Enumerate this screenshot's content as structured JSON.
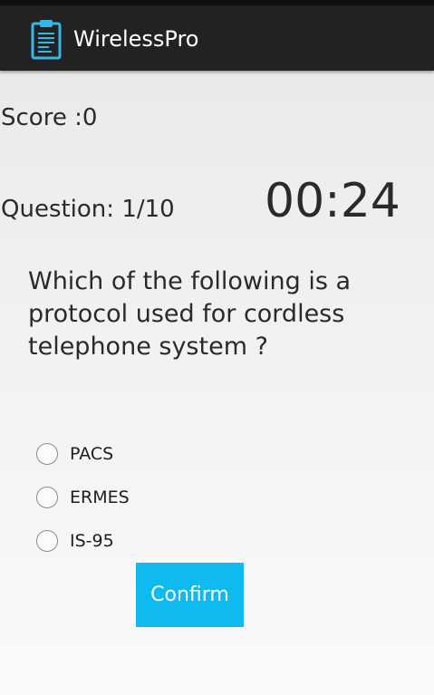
{
  "app": {
    "title": "WirelessPro",
    "icon": "clipboard-icon",
    "accent_color": "#0fbaf0"
  },
  "quiz": {
    "score_text": "Score :0",
    "question_counter": "Question: 1/10",
    "timer": "00:24",
    "question": "Which of the following is a protocol used for cordless telephone system ?",
    "options": [
      {
        "label": "PACS",
        "selected": false
      },
      {
        "label": "ERMES",
        "selected": false
      },
      {
        "label": "IS-95",
        "selected": false
      }
    ],
    "confirm_label": "Confirm"
  }
}
